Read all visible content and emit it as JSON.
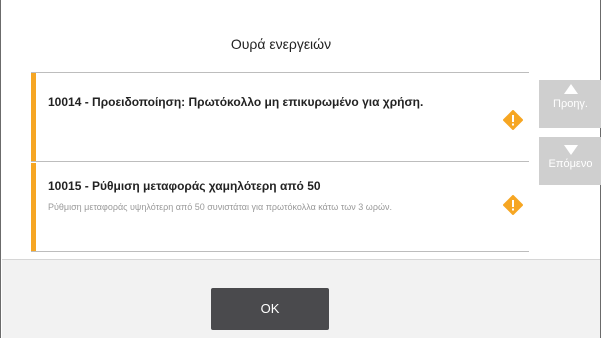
{
  "dialog": {
    "title": "Ουρά ενεργειών",
    "items": [
      {
        "code_title": "10014 - Προειδοποίηση: Πρωτόκολλο μη επικυρωμένο για χρήση.",
        "description": "",
        "severity_icon": "warning-icon",
        "accent_color": "#f6a623"
      },
      {
        "code_title": "10015 - Ρύθμιση μεταφοράς χαμηλότερη από 50",
        "description": "Ρύθμιση μεταφοράς υψηλότερη από 50 συνιστάται για πρωτόκολλα κάτω των 3 ωρών.",
        "severity_icon": "warning-icon",
        "accent_color": "#f6a623"
      }
    ],
    "nav": {
      "prev_label": "Προηγ.",
      "next_label": "Επόμενο",
      "prev_icon": "arrow-up-icon",
      "next_icon": "arrow-down-icon"
    },
    "ok_label": "OK"
  }
}
